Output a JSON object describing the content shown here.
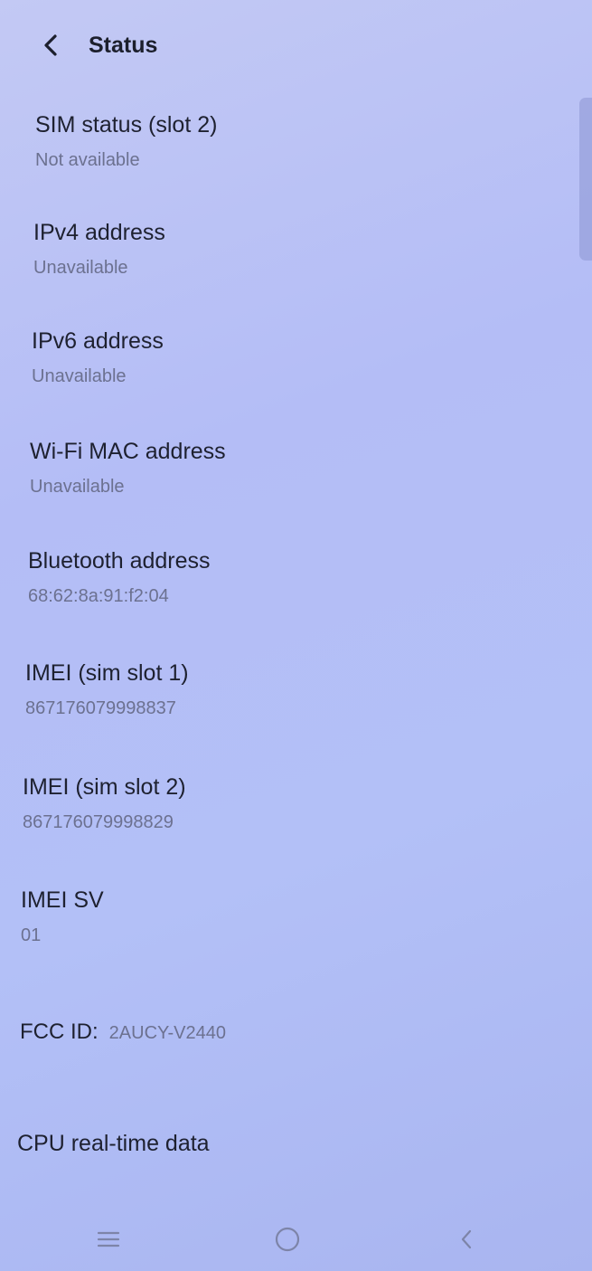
{
  "header": {
    "title": "Status",
    "back_icon": "chevron-left-icon"
  },
  "items": [
    {
      "label": "SIM status (slot 2)",
      "value": "Not available"
    },
    {
      "label": "IPv4 address",
      "value": "Unavailable"
    },
    {
      "label": "IPv6 address",
      "value": "Unavailable"
    },
    {
      "label": "Wi-Fi MAC address",
      "value": "Unavailable"
    },
    {
      "label": "Bluetooth address",
      "value": "68:62:8a:91:f2:04"
    },
    {
      "label": "IMEI (sim slot 1)",
      "value": "867176079998837"
    },
    {
      "label": "IMEI (sim slot 2)",
      "value": "867176079998829"
    },
    {
      "label": "IMEI SV",
      "value": "01"
    }
  ],
  "fcc": {
    "label": "FCC ID:",
    "value": "2AUCY-V2440"
  },
  "cpu": {
    "label": "CPU real-time data"
  },
  "navbar": {
    "recents_icon": "menu-icon",
    "home_icon": "home-circle-icon",
    "back_icon": "back-chevron-icon"
  },
  "colors": {
    "background": "#b4bdf6",
    "text_primary": "#1e2130",
    "text_secondary": "#6c7190"
  }
}
